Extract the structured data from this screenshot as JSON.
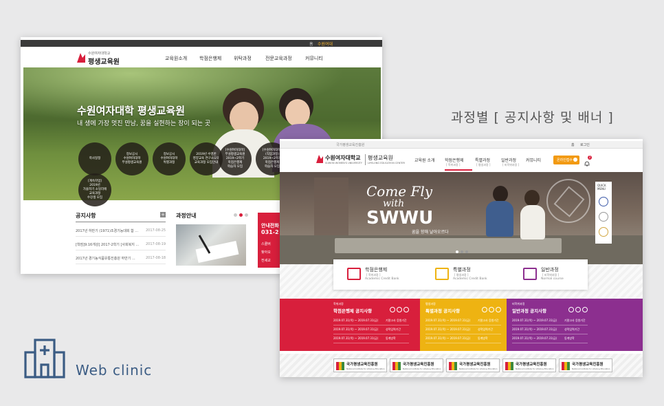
{
  "heading": "과정별 [ 공지사항 및 배너 ]",
  "brand": {
    "name": "Web clinic"
  },
  "colors": {
    "red": "#d81f3c",
    "yellow": "#eeb312",
    "purple": "#8c2f8f",
    "orange": "#f29a12",
    "dark": "#333333",
    "bg": "#e9e9ea"
  },
  "site1": {
    "topbar": {
      "home": "홈",
      "login": "수원여대"
    },
    "logo": {
      "small": "수원여자대학교",
      "main": "평생교육원"
    },
    "nav": [
      "교육원소개",
      "학점은행제",
      "위탁과정",
      "전문교육과정",
      "커뮤니티"
    ],
    "hero": {
      "title": "수원여자대학 평생교육원",
      "subtitle": "내 생에 가장 멋진 만남, 꿈을 실현하는 장이 되는 곳"
    },
    "circles": [
      {
        "lines": [
          "학사일정"
        ]
      },
      {
        "lines": [
          "정보공시",
          "수원여자대학",
          "부설평생교육원"
        ]
      },
      {
        "lines": [
          "정보공시",
          "수원여자대학",
          "특별과정"
        ]
      },
      {
        "lines": [
          "2019년 수영반",
          "영양교육 연구소모의",
          "교육과정 모집안내"
        ]
      },
      {
        "lines": [
          "[수원여자대학]",
          "부설평생교육원",
          "2019~2학기",
          "학점은행제",
          "학습자 모집"
        ]
      },
      {
        "lines": [
          "[수원여자대학]",
          "(직업과정)",
          "2019~2학기",
          "학점은행제",
          "학습자 모집"
        ]
      },
      {
        "lines": [
          "[계속학업]",
          "2019년",
          "가을학기 소일리에",
          "교육과정",
          "수강생 모집"
        ]
      }
    ],
    "notice": {
      "title": "공지사항",
      "items": [
        {
          "text": "2017년 하반기 (1971)조경기능대회 합 ...",
          "date": "2017-08-25"
        },
        {
          "text": "[학점]9.16개강] 2017-2학기 [사회복지 ...",
          "date": "2017-08-19"
        },
        {
          "text": "2017년 경기농식품유통진흥원 하반기 ...",
          "date": "2017-08-18"
        }
      ]
    },
    "course": {
      "title": "과정안내"
    },
    "info": {
      "title": "안내전화",
      "phone": "031-2",
      "items": [
        "스쿨버",
        "찾아오",
        "전세교"
      ]
    }
  },
  "site2": {
    "topbar": {
      "left": "국가평생교육진흥원",
      "right1": "홈",
      "right2": "로그인"
    },
    "logo": {
      "main": "수원여자대학교",
      "sub": "SUWON WOMEN'S UNIVERSITY",
      "title": "평생교육원",
      "sub2": "LIFELONG EDUCATION CENTER"
    },
    "nav": [
      {
        "label": "교육원 소개",
        "sub": ""
      },
      {
        "label": "학점은행제",
        "sub": "[ 학위과정 ]"
      },
      {
        "label": "특별과정",
        "sub": "[ 평생과정 ]"
      },
      {
        "label": "일반과정",
        "sub": "[ 비학위과정 ]"
      },
      {
        "label": "커뮤니티",
        "sub": ""
      }
    ],
    "apply": "온라인접수",
    "badge": "2",
    "hero": {
      "script1": "Come Fly",
      "script2": "with",
      "big": "SWWU",
      "sub": "꿈을 향해 날아오르다",
      "seal": "수원여자대학교 · WOMEN'S UNIVERSITY"
    },
    "quick": {
      "line1": "QUICK",
      "line2": "MENU"
    },
    "courses": [
      {
        "title": "학점은행제",
        "sub1": "[ 학위과정 ]",
        "sub2": "Academic Credit Bank",
        "color": "#d81f3c"
      },
      {
        "title": "특별과정",
        "sub1": "[ 평생과정 ]",
        "sub2": "Academic Credit Bank",
        "color": "#eeb312"
      },
      {
        "title": "일반과정",
        "sub1": "[ 비학위과정 ]",
        "sub2": "Normal course",
        "color": "#8c2f8f"
      }
    ],
    "notices": [
      {
        "tag": "학위과정",
        "title": "학점은행제 공지사항",
        "color": "#d81f3c",
        "rows": [
          {
            "date": "2019.07.31(목) ~ 2019.07.31(금)",
            "desc": "기말고사 응원기간"
          },
          {
            "date": "2019.07.31(목) ~ 2019.07.31(금)",
            "desc": "성적입력기간"
          },
          {
            "date": "2019.07.31(목) ~ 2019.07.31(금)",
            "desc": "동계방학"
          }
        ]
      },
      {
        "tag": "평생과정",
        "title": "특별과정 공지사항",
        "color": "#eeb312",
        "rows": [
          {
            "date": "2019.07.31(목) ~ 2019.07.31(금)",
            "desc": "기말고사 응원기간"
          },
          {
            "date": "2019.07.31(목) ~ 2019.07.31(금)",
            "desc": "성적입력기간"
          },
          {
            "date": "2019.07.31(목) ~ 2019.07.31(금)",
            "desc": "동계방학"
          }
        ]
      },
      {
        "tag": "비학위과정",
        "title": "일반과정 공지사항",
        "color": "#8c2f8f",
        "rows": [
          {
            "date": "2019.07.31(목) ~ 2019.07.31(금)",
            "desc": "기말고사 응원기간"
          },
          {
            "date": "2019.07.31(목) ~ 2019.07.31(금)",
            "desc": "성적입력기간"
          },
          {
            "date": "2019.07.31(목) ~ 2019.07.31(금)",
            "desc": "동계방학"
          }
        ]
      }
    ],
    "banners": [
      {
        "name": "국가평생교육진흥원",
        "en": "National Institute for Lifelong Education"
      },
      {
        "name": "국가평생교육진흥원",
        "en": "National Institute for Lifelong Education"
      },
      {
        "name": "국가평생교육진흥원",
        "en": "National Institute for Lifelong Education"
      },
      {
        "name": "국가평생교육진흥원",
        "en": "National Institute for Lifelong Education"
      },
      {
        "name": "국가평생교육진흥원",
        "en": "National Institute for Lifelong Education"
      }
    ]
  }
}
